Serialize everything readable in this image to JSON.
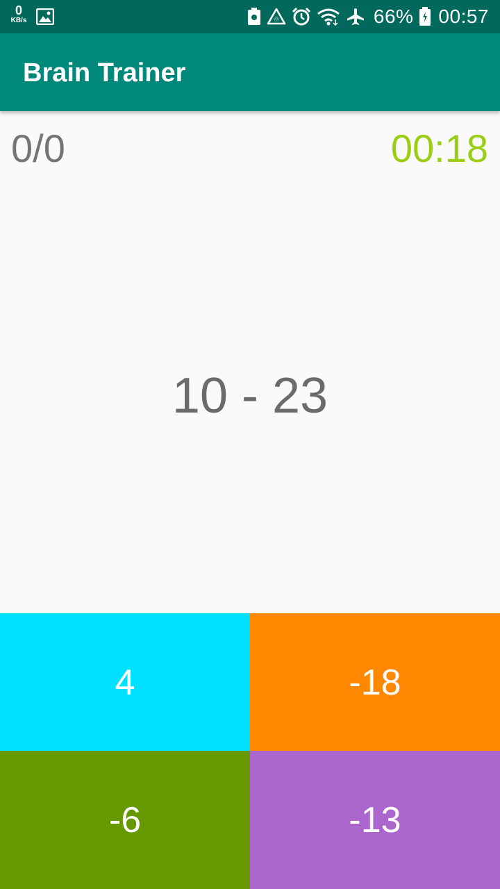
{
  "status_bar": {
    "net_speed_value": "0",
    "net_speed_unit": "KB/s",
    "battery_percent": "66%",
    "time": "00:57",
    "icons": [
      "image-icon",
      "nfc-icon",
      "recycle-icon",
      "alarm-icon",
      "wifi-icon",
      "airplane-icon",
      "battery-icon"
    ]
  },
  "app_bar": {
    "title": "Brain Trainer",
    "color": "#00897b"
  },
  "game": {
    "score": "0/0",
    "timer": "00:18",
    "timer_color": "#9acd14",
    "question": "10 - 23",
    "answers": [
      {
        "label": "4",
        "color": "#00e0ff"
      },
      {
        "label": "-18",
        "color": "#ff8800"
      },
      {
        "label": "-6",
        "color": "#669900"
      },
      {
        "label": "-13",
        "color": "#aa66cc"
      }
    ]
  }
}
